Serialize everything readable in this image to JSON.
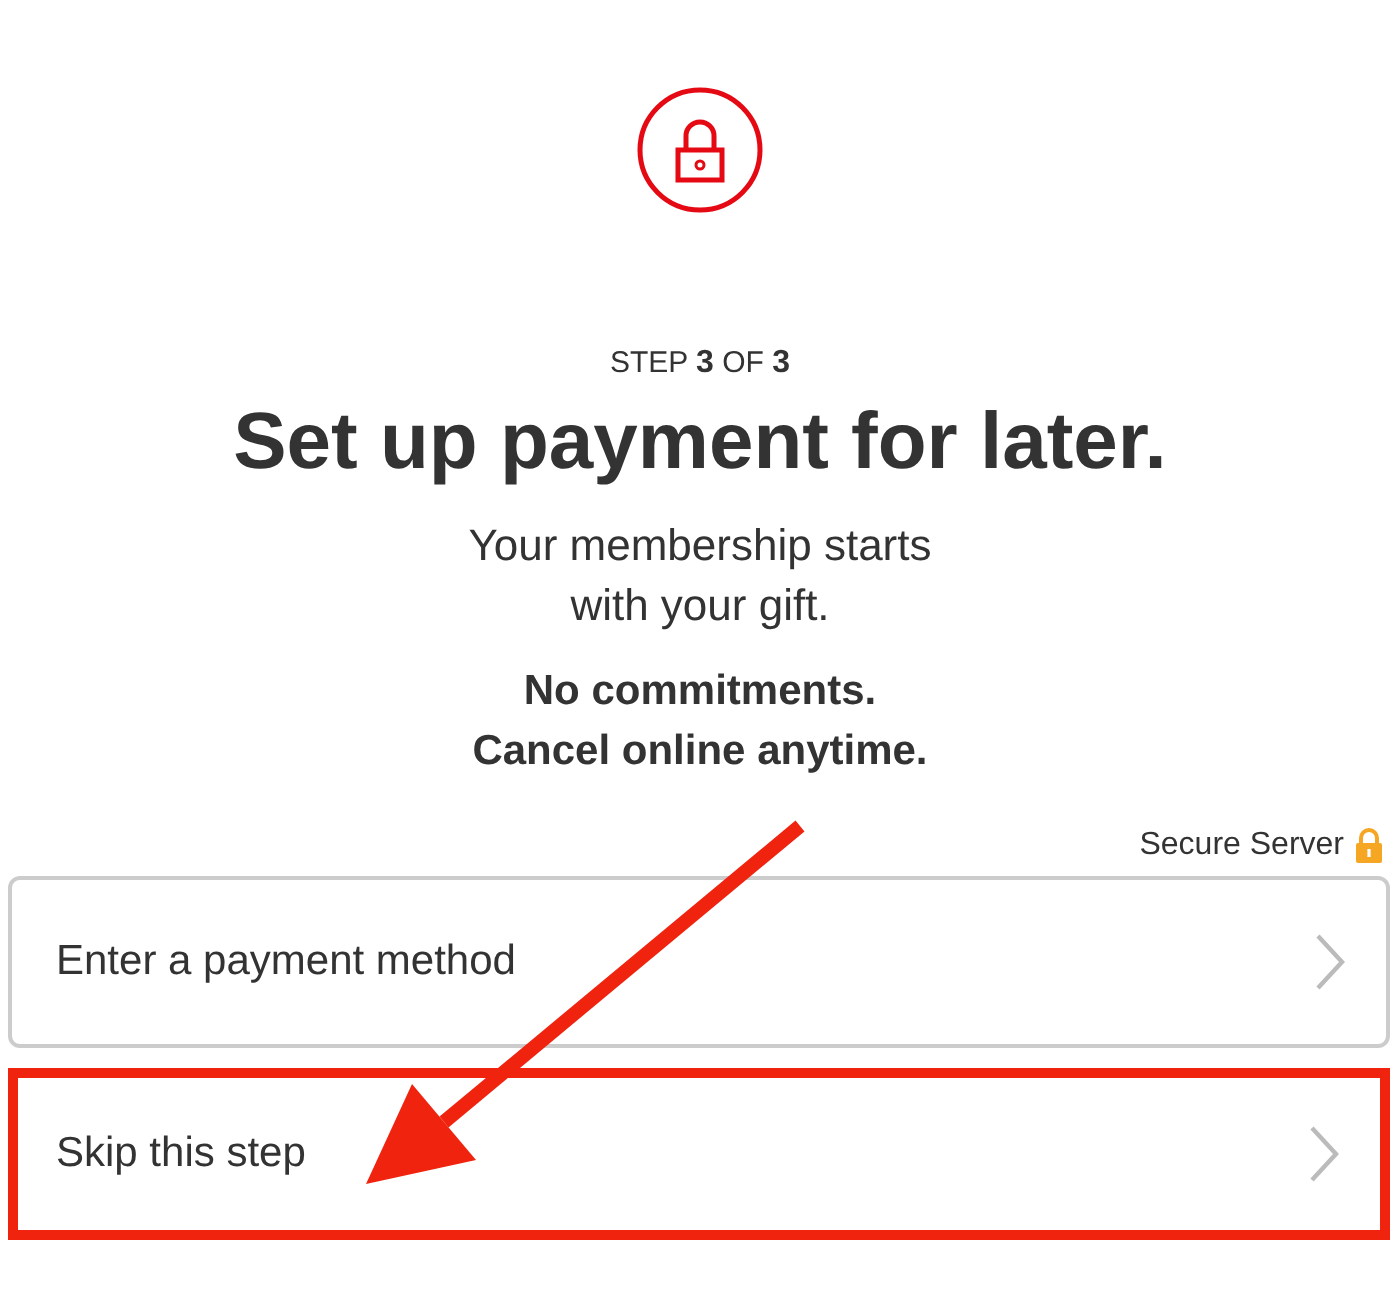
{
  "step": "STEP **3** OF **3**",
  "title": "Set up payment for later.",
  "subtitle": [
    "Your membership starts",
    "with your gift."
  ],
  "terms": [
    "No commitments.",
    "Cancel online anytime."
  ],
  "secure_label": "Secure Server",
  "options": [
    {
      "label": "Enter a payment method",
      "highlighted": false
    },
    {
      "label": "Skip this step",
      "highlighted": true
    }
  ]
}
